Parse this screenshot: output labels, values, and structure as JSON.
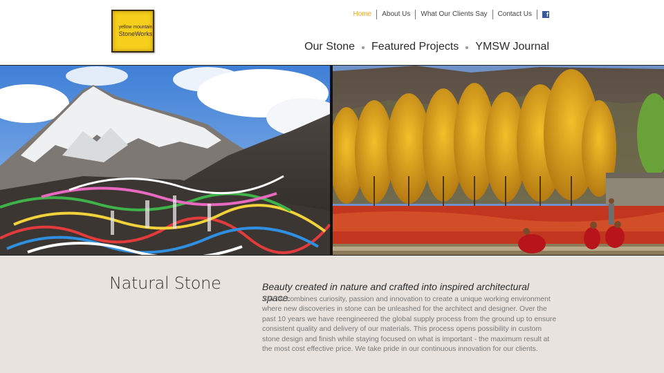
{
  "logo": {
    "line1": "yellow mountain",
    "line2": "StoneWorks"
  },
  "top_nav": {
    "items": [
      "Home",
      "About Us",
      "What Our Clients Say",
      "Contact Us"
    ],
    "facebook_glyph": "f",
    "active_color": "#e8a92a"
  },
  "main_nav": {
    "items": [
      "Our Stone",
      "Featured Projects",
      "YMSW Journal"
    ]
  },
  "content": {
    "title": "Natural Stone",
    "tagline": "Beauty created in nature and crafted into inspired architectural space.",
    "body": "YMSW combines curiosity, passion and innovation to create a unique working environment where new discoveries in stone can be unleashed for the architect and designer. Over the past 10 years we have reengineered the global supply process from the ground up to ensure consistent quality and delivery of our materials. This process opens possibility in custom stone design and finish while staying focused on what is important - the maximum result at the most cost effective price. We take pride in our continuous innovation for our clients."
  },
  "colors": {
    "logo_yellow": "#f5cf1c",
    "content_bg": "#e8e3df",
    "facebook_blue": "#3b5998"
  }
}
